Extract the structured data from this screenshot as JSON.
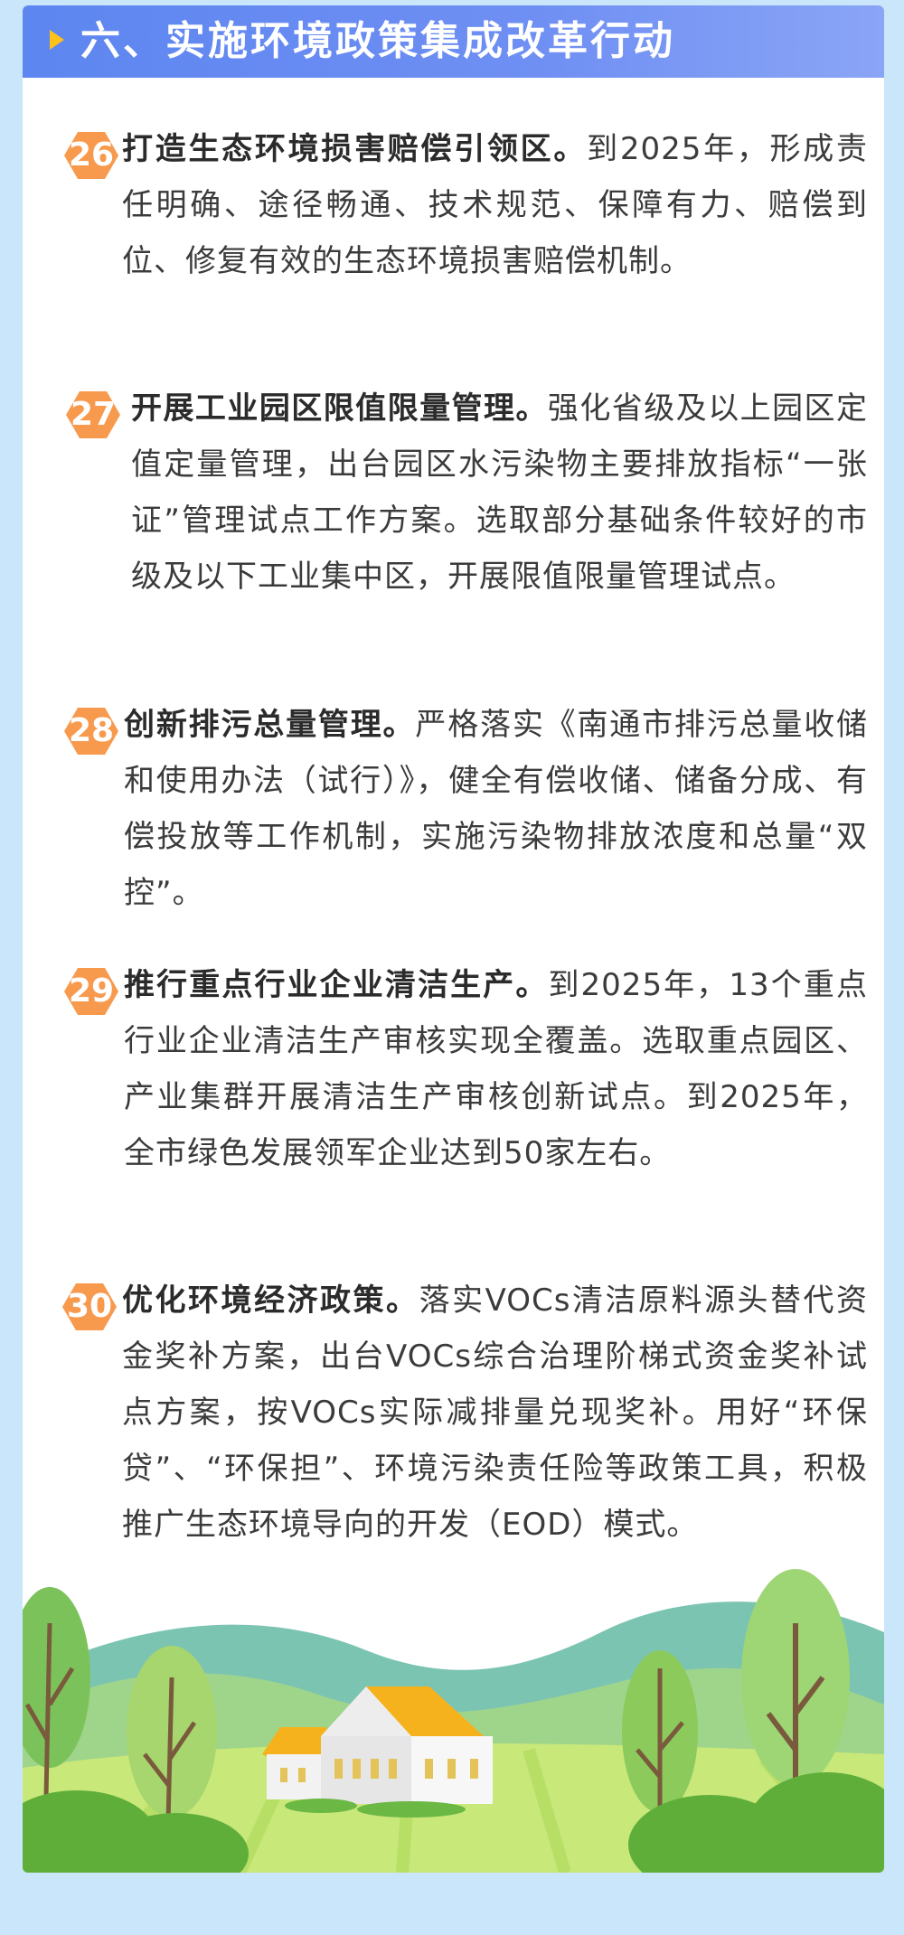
{
  "header": {
    "title": "六、实施环境政策集成改革行动"
  },
  "items": [
    {
      "number": "26",
      "title": "打造生态环境损害赔偿引领区。",
      "body": "到2025年，形成责任明确、途径畅通、技术规范、保障有力、赔偿到位、修复有效的生态环境损害赔偿机制。"
    },
    {
      "number": "27",
      "title": "开展工业园区限值限量管理。",
      "body": "强化省级及以上园区定值定量管理，出台园区水污染物主要排放指标“一张证”管理试点工作方案。选取部分基础条件较好的市级及以下工业集中区，开展限值限量管理试点。"
    },
    {
      "number": "28",
      "title": "创新排污总量管理。",
      "body": "严格落实《南通市排污总量收储和使用办法（试行）》，健全有偿收储、储备分成、有偿投放等工作机制，实施污染物排放浓度和总量“双控”。"
    },
    {
      "number": "29",
      "title": "推行重点行业企业清洁生产。",
      "body": "到2025年，13个重点行业企业清洁生产审核实现全覆盖。选取重点园区、产业集群开展清洁生产审核创新试点。到2025年，全市绿色发展领军企业达到50家左右。"
    },
    {
      "number": "30",
      "title": "优化环境经济政策。",
      "body": "落实VOCs清洁原料源头替代资金奖补方案，出台VOCs综合治理阶梯式资金奖补试点方案，按VOCs实际减排量兑现奖补。用好“环保贷”、“环保担”、环境污染责任险等政策工具，积极推广生态环境导向的开发（EOD）模式。"
    }
  ],
  "colors": {
    "header": "#6a8cf2",
    "badge": "#f79a4e",
    "arrow": "#ffc21a",
    "background": "#c9e6fb"
  }
}
